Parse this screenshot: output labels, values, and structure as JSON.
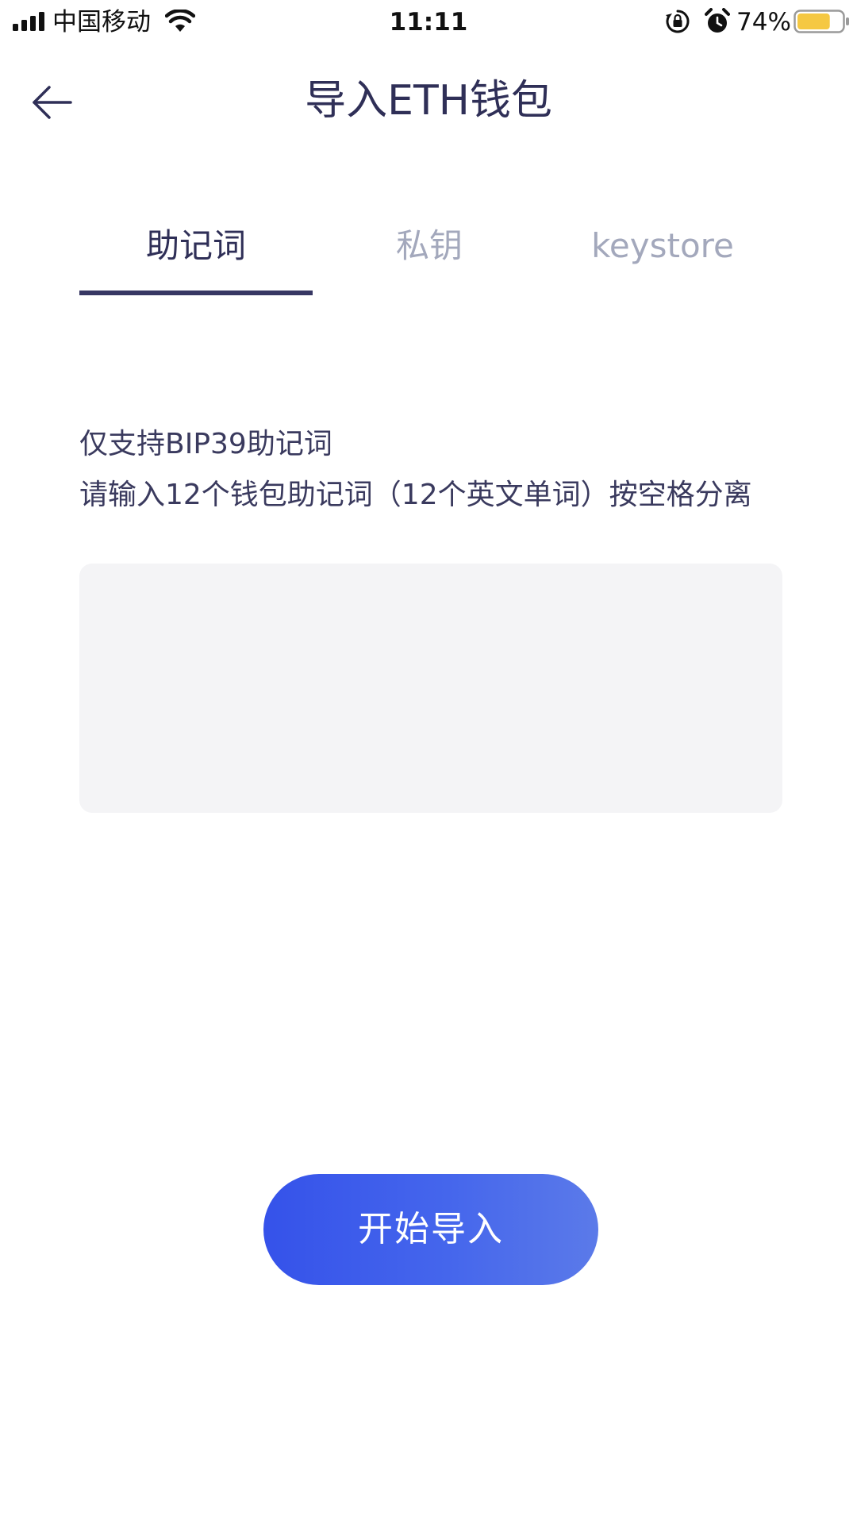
{
  "status_bar": {
    "carrier": "中国移动",
    "time": "11:11",
    "battery_percent": "74%",
    "battery_level": 0.74,
    "battery_color": "#f5c842",
    "icons": [
      "signal-icon",
      "wifi-icon",
      "rotation-lock-icon",
      "alarm-icon",
      "battery-icon"
    ]
  },
  "header": {
    "title": "导入ETH钱包",
    "back_icon": "back-arrow-icon"
  },
  "tabs": [
    {
      "label": "助记词",
      "active": true
    },
    {
      "label": "私钥",
      "active": false
    },
    {
      "label": "keystore",
      "active": false
    }
  ],
  "instructions": {
    "line1": "仅支持BIP39助记词",
    "line2": "请输入12个钱包助记词（12个英文单词）按空格分离"
  },
  "mnemonic_input": {
    "value": "",
    "placeholder": ""
  },
  "import_button": {
    "label": "开始导入"
  },
  "colors": {
    "text_primary": "#2f2f57",
    "tab_inactive": "#a3a8bc",
    "tab_indicator": "#373763",
    "input_background": "#f4f4f6",
    "button_gradient_start": "#3552ea",
    "button_gradient_end": "#5b7ae9"
  }
}
